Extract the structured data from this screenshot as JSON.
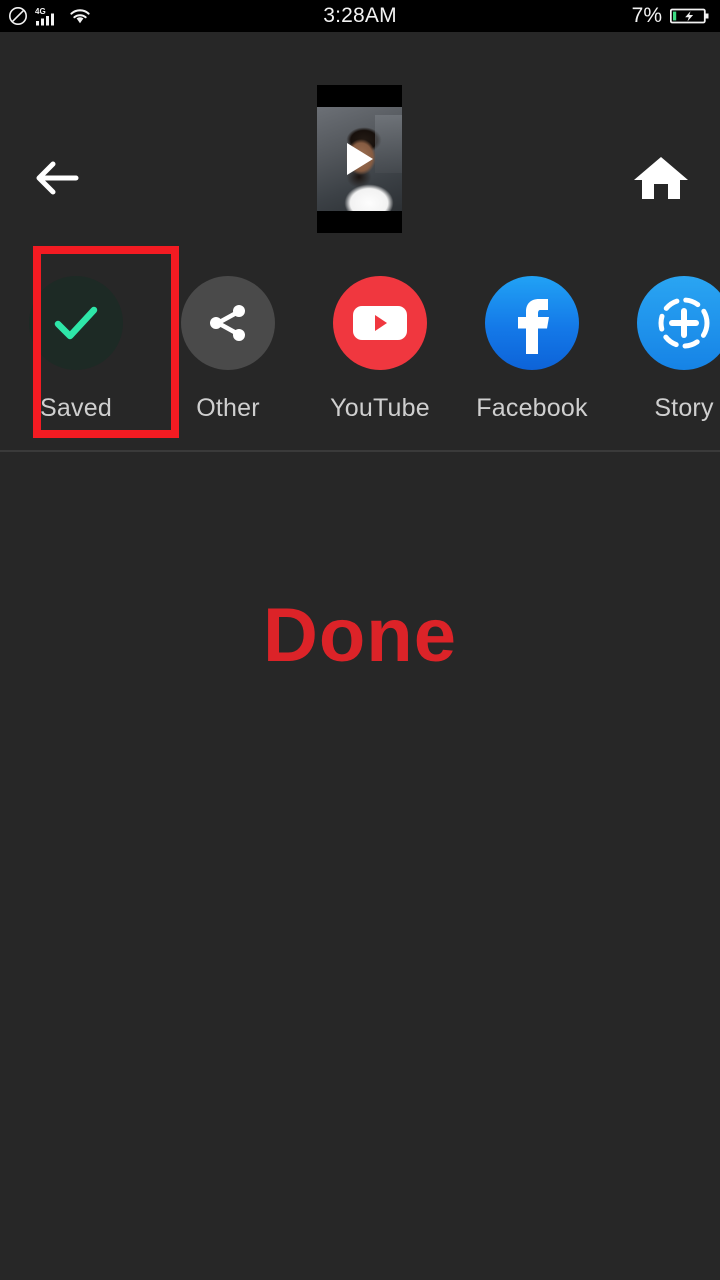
{
  "status_bar": {
    "time": "3:28AM",
    "battery_percent": "7%",
    "network_label": "4G",
    "icons": [
      "do-not-disturb-icon",
      "signal-4g-icon",
      "wifi-icon",
      "battery-charging-icon"
    ],
    "background_color": "#000000",
    "text_color": "#f2f2f2",
    "battery_fill_color": "#3ddc84"
  },
  "header": {
    "back_icon": "arrow-left-icon",
    "home_icon": "home-icon",
    "thumbnail": {
      "name": "video-thumbnail",
      "play_icon": "play-triangle-icon"
    }
  },
  "share_row": {
    "items": [
      {
        "label": "Saved",
        "icon": "check-icon",
        "circle_color": "#1d2a25",
        "icon_color": "#2ee6a8",
        "highlighted": true
      },
      {
        "label": "Other",
        "icon": "share-nodes-icon",
        "circle_color": "#4a4a4a",
        "icon_color": "#ffffff",
        "highlighted": false
      },
      {
        "label": "YouTube",
        "icon": "youtube-icon",
        "circle_color": "#f0373f",
        "icon_color": "#ffffff",
        "highlighted": false
      },
      {
        "label": "Facebook",
        "icon": "facebook-icon",
        "circle_color": "#1479e8",
        "icon_color": "#ffffff",
        "highlighted": false
      },
      {
        "label": "Story",
        "icon": "story-add-icon",
        "circle_color": "#1683e6",
        "icon_color": "#ffffff",
        "highlighted": false
      }
    ],
    "highlight_color": "#f31b22"
  },
  "main": {
    "status_message": "Done",
    "status_color": "#dc2328"
  },
  "theme": {
    "background": "#272727",
    "label_color": "#cfcfcf",
    "divider_color": "#3a3a3a"
  }
}
